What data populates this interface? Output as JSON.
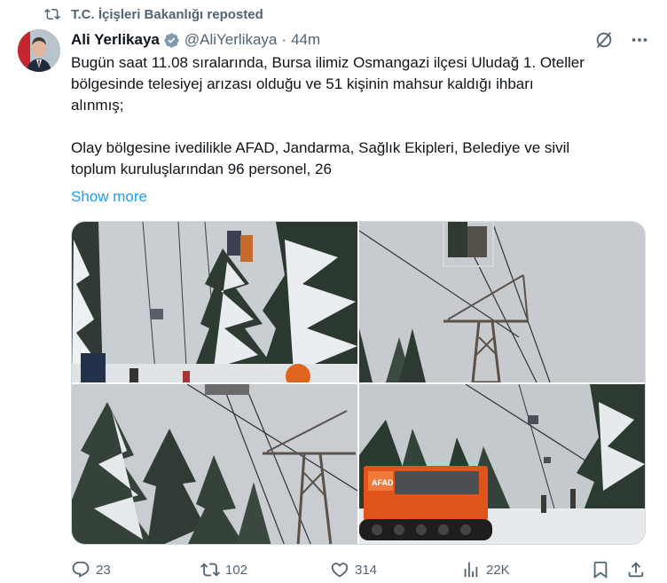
{
  "repost_banner": {
    "text": "T.C. İçişleri Bakanlığı reposted",
    "icon": "repost-icon"
  },
  "author": {
    "name": "Ali Yerlikaya",
    "handle": "@AliYerlikaya",
    "separator": "·",
    "time": "44m",
    "verified": true,
    "badge_color": "#829aab"
  },
  "tweet": {
    "line1": "Bugün saat 11.08 sıralarında, Bursa ilimiz Osmangazi ilçesi Uludağ 1. Oteller",
    "line2": "bölgesinde telesiyej arızası olduğu ve 51 kişinin mahsur kaldığı ihbarı",
    "line3": "alınmış;",
    "line4": "Olay bölgesine ivedilikle AFAD, Jandarma, Sağlık Ekipleri, Belediye ve sivil",
    "line5": "toplum kuruluşlarından 96 personel, 26",
    "show_more": "Show more"
  },
  "media": [
    {
      "alt_icon": "photo-chairlift-rescue"
    },
    {
      "alt_icon": "photo-lift-pylon-basket"
    },
    {
      "alt_icon": "photo-lift-pylon-trees"
    },
    {
      "alt_icon": "photo-afad-snow-vehicle",
      "vehicle_label": "AFAD"
    }
  ],
  "actions": {
    "replies": "23",
    "reposts": "102",
    "likes": "314",
    "views": "22K"
  },
  "colors": {
    "link": "#1d9bf0",
    "muted": "#536471",
    "afad_orange": "#e0541c"
  }
}
